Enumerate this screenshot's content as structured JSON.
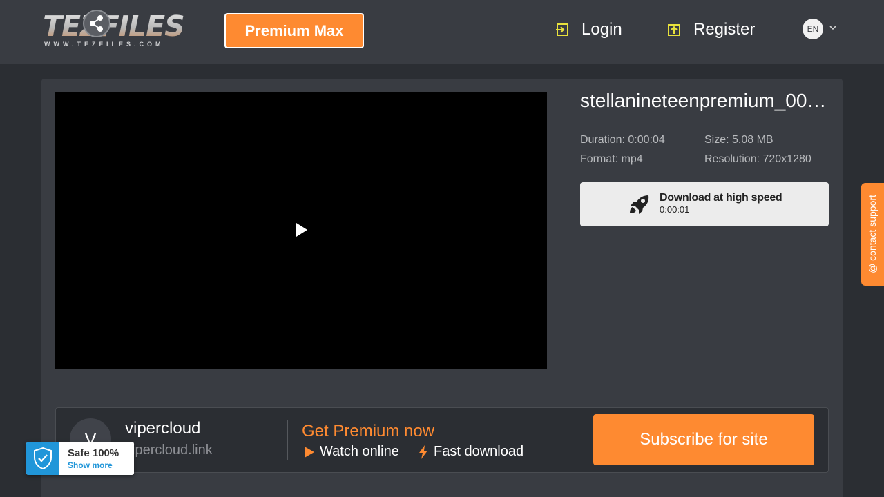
{
  "header": {
    "logo_text": "TEZFILES",
    "logo_sub": "WWW.TEZFILES.COM",
    "premium_label": "Premium Max",
    "login_label": "Login",
    "register_label": "Register",
    "lang": "EN"
  },
  "file": {
    "title": "stellanineteenpremium_00…",
    "duration": "Duration: 0:00:04",
    "size": "Size: 5.08 MB",
    "format": "Format: mp4",
    "resolution": "Resolution: 720x1280",
    "download_label": "Download at high speed",
    "download_timer": "0:00:01"
  },
  "support": {
    "label": "@ contact support"
  },
  "promo": {
    "avatar_letter": "V",
    "site_name": "vipercloud",
    "site_url": "vipercloud.link",
    "title": "Get Premium now",
    "feature_watch": "Watch online",
    "feature_fast": "Fast download",
    "subscribe_label": "Subscribe for site"
  },
  "safe_badge": {
    "title": "Safe 100%",
    "more": "Show more"
  },
  "colors": {
    "accent": "#fe8a31",
    "header_bg": "#393c42",
    "page_bg": "#2b2e33",
    "icon_yellow": "#e8e23c"
  }
}
